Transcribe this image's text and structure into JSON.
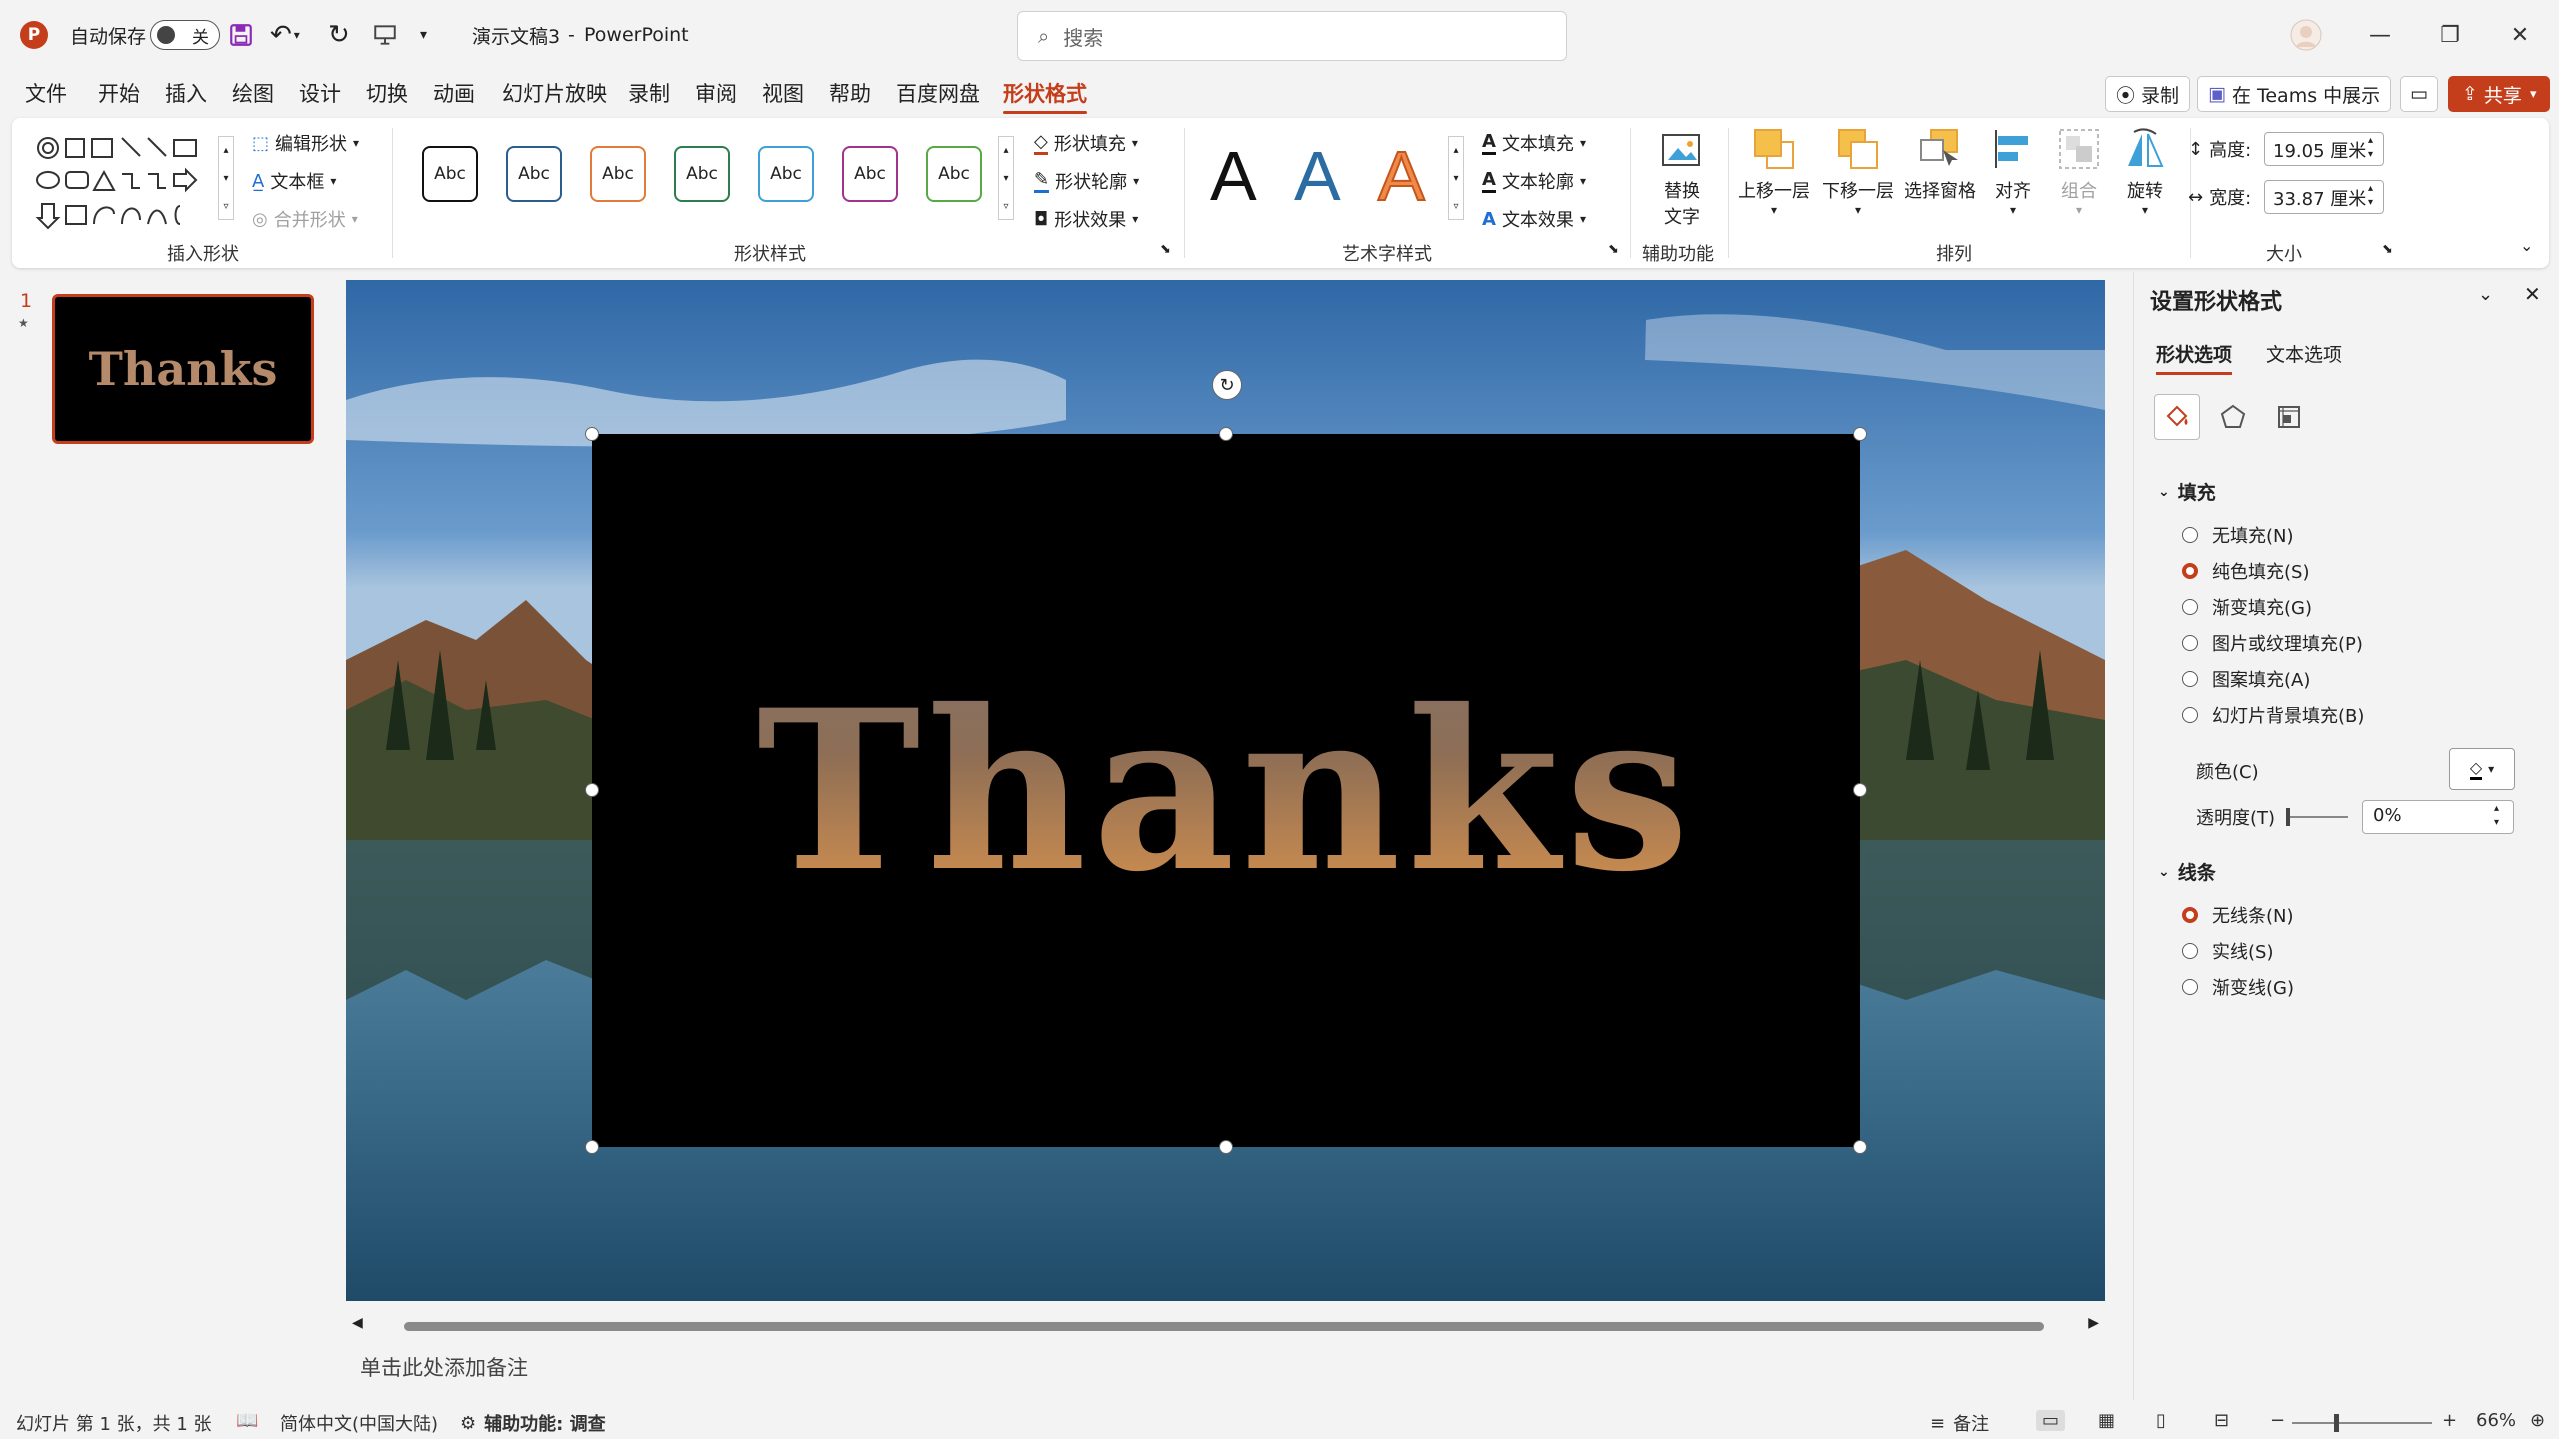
{
  "titlebar": {
    "autosave_label": "自动保存",
    "autosave_state": "关",
    "doc_title": "演示文稿3",
    "separator": "-",
    "app_name": "PowerPoint",
    "search_placeholder": "搜索"
  },
  "menu": {
    "tabs": [
      "文件",
      "开始",
      "插入",
      "绘图",
      "设计",
      "切换",
      "动画",
      "幻灯片放映",
      "录制",
      "审阅",
      "视图",
      "帮助",
      "百度网盘",
      "形状格式"
    ],
    "active_tab": "形状格式",
    "record_label": "录制",
    "teams_label": "在 Teams 中展示",
    "share_label": "共享"
  },
  "ribbon": {
    "insert_shapes": {
      "edit_shape": "编辑形状",
      "text_box": "文本框",
      "merge_shapes": "合并形状",
      "label": "插入形状"
    },
    "shape_styles": {
      "swatch_text": "Abc",
      "fill": "形状填充",
      "outline": "形状轮廓",
      "effects": "形状效果",
      "label": "形状样式"
    },
    "wordart": {
      "letter": "A",
      "text_fill": "文本填充",
      "text_outline": "文本轮廓",
      "text_effects": "文本效果",
      "label": "艺术字样式"
    },
    "accessibility": {
      "alt_text_line1": "替换",
      "alt_text_line2": "文字",
      "label": "辅助功能"
    },
    "arrange": {
      "bring_forward": "上移一层",
      "send_backward": "下移一层",
      "selection_pane": "选择窗格",
      "align": "对齐",
      "group": "组合",
      "rotate": "旋转",
      "label": "排列"
    },
    "size": {
      "height_label": "高度:",
      "height_value": "19.05 厘米",
      "width_label": "宽度:",
      "width_value": "33.87 厘米",
      "label": "大小"
    }
  },
  "thumbnails": {
    "slide_number": "1",
    "star": "★",
    "thumb_text": "Thanks"
  },
  "slide": {
    "text": "Thanks"
  },
  "notes": {
    "placeholder": "单击此处添加备注"
  },
  "format_pane": {
    "title": "设置形状格式",
    "tabs": [
      "形状选项",
      "文本选项"
    ],
    "fill_section": "填充",
    "fill_options": [
      "无填充(N)",
      "纯色填充(S)",
      "渐变填充(G)",
      "图片或纹理填充(P)",
      "图案填充(A)",
      "幻灯片背景填充(B)"
    ],
    "fill_selected_index": 1,
    "color_label": "颜色(C)",
    "transparency_label": "透明度(T)",
    "transparency_value": "0%",
    "line_section": "线条",
    "line_options": [
      "无线条(N)",
      "实线(S)",
      "渐变线(G)"
    ],
    "line_selected_index": 0
  },
  "statusbar": {
    "slide_info": "幻灯片 第 1 张，共 1 张",
    "language": "简体中文(中国大陆)",
    "accessibility": "辅助功能: 调查",
    "notes": "备注",
    "zoom": "66%"
  },
  "colors": {
    "accent": "#c43e1c",
    "shape_fill": "#000000"
  }
}
